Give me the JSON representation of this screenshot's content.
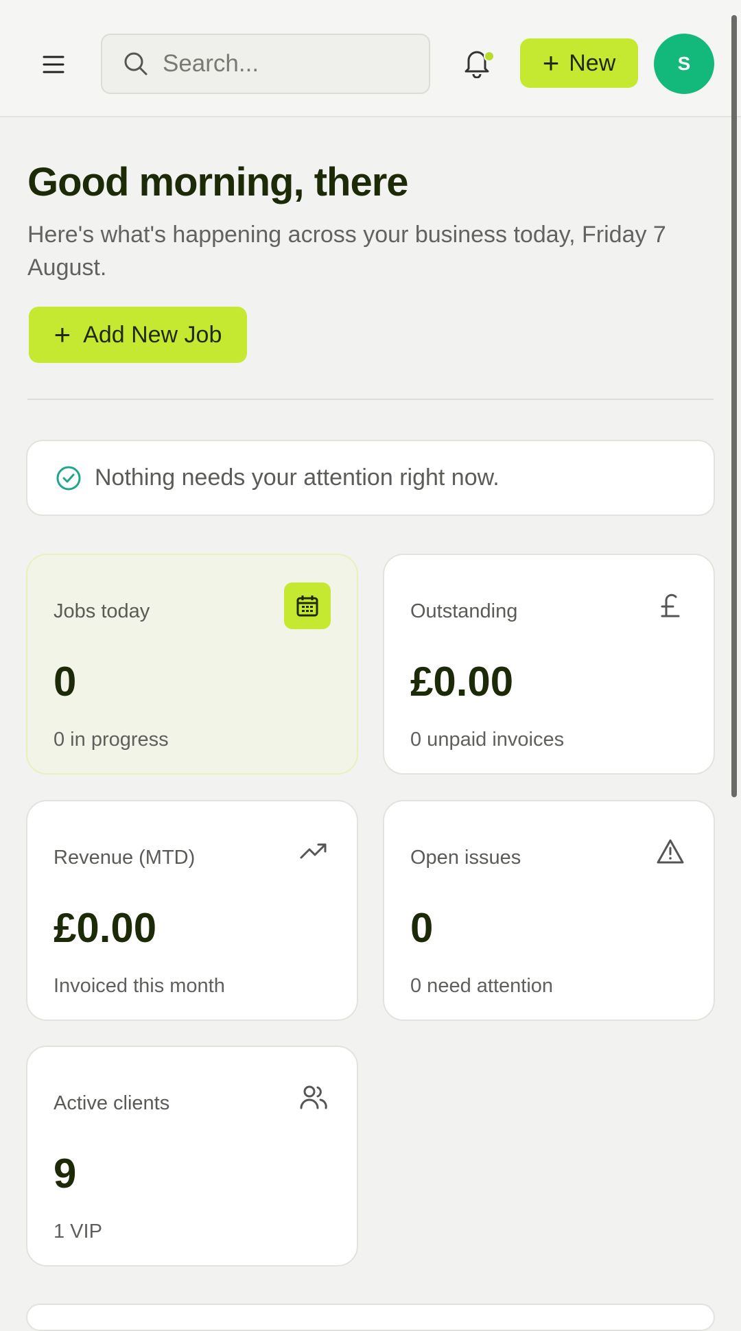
{
  "header": {
    "search_placeholder": "Search...",
    "new_button_label": "New",
    "avatar_initial": "S"
  },
  "main": {
    "greeting": "Good morning, there",
    "subtitle": "Here's what's happening across your business today, Friday 7 August.",
    "add_job_label": "Add New Job",
    "notice": "Nothing needs your attention right now."
  },
  "cards": [
    {
      "label": "Jobs today",
      "value": "0",
      "sub": "0 in progress",
      "icon": "calendar-icon"
    },
    {
      "label": "Outstanding",
      "value": "£0.00",
      "sub": "0 unpaid invoices",
      "icon": "pound-icon"
    },
    {
      "label": "Revenue (MTD)",
      "value": "£0.00",
      "sub": "Invoiced this month",
      "icon": "trending-up-icon"
    },
    {
      "label": "Open issues",
      "value": "0",
      "sub": "0 need attention",
      "icon": "warning-icon"
    },
    {
      "label": "Active clients",
      "value": "9",
      "sub": "1 VIP",
      "icon": "users-icon"
    }
  ],
  "colors": {
    "accent": "#c5e830",
    "avatar": "#13b97a",
    "success": "#1fa58a"
  }
}
